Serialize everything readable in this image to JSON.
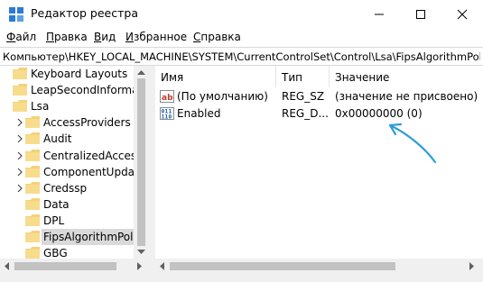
{
  "window": {
    "title": "Редактор реестра"
  },
  "menu": [
    {
      "first": "Ф",
      "rest": "айл"
    },
    {
      "first": "П",
      "rest": "равка"
    },
    {
      "first": "В",
      "rest": "ид"
    },
    {
      "first": "И",
      "rest": "збранное"
    },
    {
      "first": "С",
      "rest": "правка"
    }
  ],
  "address": "Компьютер\\HKEY_LOCAL_MACHINE\\SYSTEM\\CurrentControlSet\\Control\\Lsa\\FipsAlgorithmPolicy",
  "tree": [
    {
      "label": "Keyboard Layouts",
      "level": 0,
      "expandable": false
    },
    {
      "label": "LeapSecondInformation",
      "level": 0,
      "expandable": false
    },
    {
      "label": "Lsa",
      "level": 0,
      "expandable": false,
      "expanded": true
    },
    {
      "label": "AccessProviders",
      "level": 1,
      "expandable": true
    },
    {
      "label": "Audit",
      "level": 1,
      "expandable": true
    },
    {
      "label": "CentralizedAccessPoli",
      "level": 1,
      "expandable": true
    },
    {
      "label": "ComponentUpdates",
      "level": 1,
      "expandable": true
    },
    {
      "label": "Credssp",
      "level": 1,
      "expandable": true
    },
    {
      "label": "Data",
      "level": 1,
      "expandable": false
    },
    {
      "label": "DPL",
      "level": 1,
      "expandable": false
    },
    {
      "label": "FipsAlgorithmPolicy",
      "level": 1,
      "expandable": false,
      "selected": true
    },
    {
      "label": "GBG",
      "level": 1,
      "expandable": false
    }
  ],
  "list": {
    "columns": [
      "Имя",
      "Тип",
      "Значение"
    ],
    "rows": [
      {
        "icon": "string-value-icon",
        "name": "(По умолчанию)",
        "type": "REG_SZ",
        "value": "(значение не присвоено)"
      },
      {
        "icon": "binary-value-icon",
        "name": "Enabled",
        "type": "REG_D...",
        "value": "0x00000000 (0)"
      }
    ]
  },
  "colors": {
    "selection": "#d9d9d9",
    "folder": "#f4d27a",
    "annotation_arrow": "#2e9fd6"
  }
}
